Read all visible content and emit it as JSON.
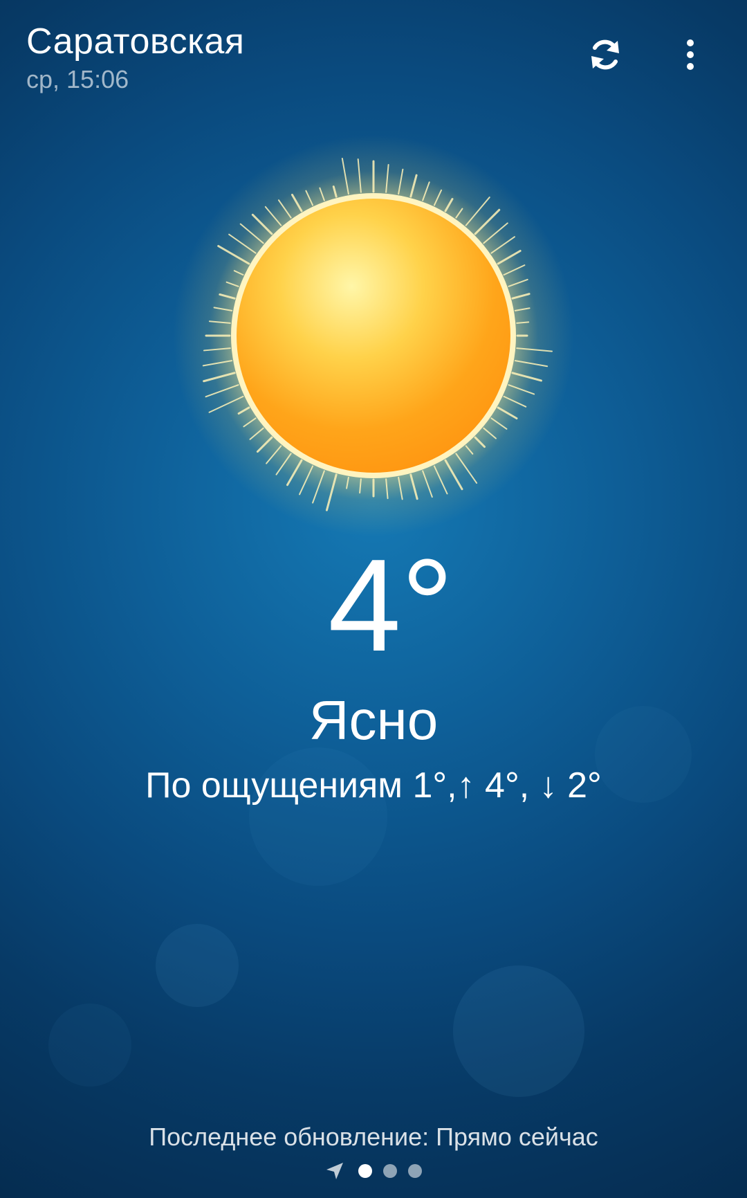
{
  "header": {
    "title": "Саратовская",
    "subtitle": "ср, 15:06",
    "refresh_icon": "refresh-icon",
    "menu_icon": "more-vert-icon"
  },
  "weather": {
    "icon": "sun-icon",
    "temperature": "4°",
    "condition": "Ясно",
    "feels_like": "По ощущениям 1°,↑ 4°, ↓ 2°"
  },
  "footer": {
    "last_update": "Последнее обновление: Прямо сейчас",
    "pager": {
      "location_icon": "location-arrow-icon",
      "pages": 3,
      "active_index": 0
    }
  },
  "colors": {
    "background_center": "#1579b4",
    "background_edge": "#052c50",
    "sun_core": "#ffb030",
    "sun_glow": "#fff2b0",
    "text": "#ffffff"
  }
}
